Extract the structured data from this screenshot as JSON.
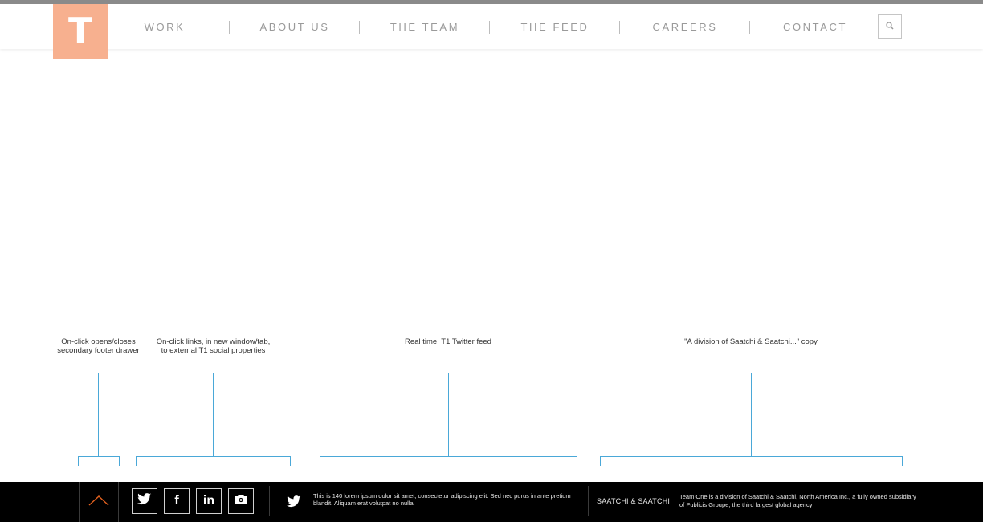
{
  "brand": {
    "logo_letter": "T"
  },
  "nav": {
    "items": [
      {
        "label": "WORK"
      },
      {
        "label": "ABOUT US"
      },
      {
        "label": "THE TEAM"
      },
      {
        "label": "THE FEED"
      },
      {
        "label": "CAREERS"
      },
      {
        "label": "CONTACT"
      }
    ],
    "search_icon": "search-icon"
  },
  "annotations": [
    {
      "text": "On-click opens/closes\nsecondary footer drawer"
    },
    {
      "text": "On-click links, in new window/tab,\nto external T1 social properties"
    },
    {
      "text": "Real time, T1 Twitter feed"
    },
    {
      "text": "\"A division of Saatchi & Saatchi...\" copy"
    }
  ],
  "footer": {
    "drawer_icon": "chevron-up-icon",
    "social": [
      {
        "icon": "twitter-icon"
      },
      {
        "icon": "facebook-icon",
        "glyph": "f"
      },
      {
        "icon": "linkedin-icon",
        "glyph": "in"
      },
      {
        "icon": "camera-icon"
      }
    ],
    "tweet_text": "This is 140 lorem ipsum dolor sit amet, consectetur adipiscing elit. Sed nec purus in ante pretium blandit. Aliquam erat volutpat no nulla.",
    "agency_label": "SAATCHI & SAATCHI",
    "division_text": "Team One is a division of Saatchi & Saatchi, North America Inc., a fully owned subsidiary of Publicis Groupe, the third largest global agency"
  },
  "colors": {
    "logo_bg": "#f7b08f",
    "annotation_line": "#4aa8d8",
    "footer_bg": "#000000",
    "drawer_chevron": "#e2611f"
  }
}
